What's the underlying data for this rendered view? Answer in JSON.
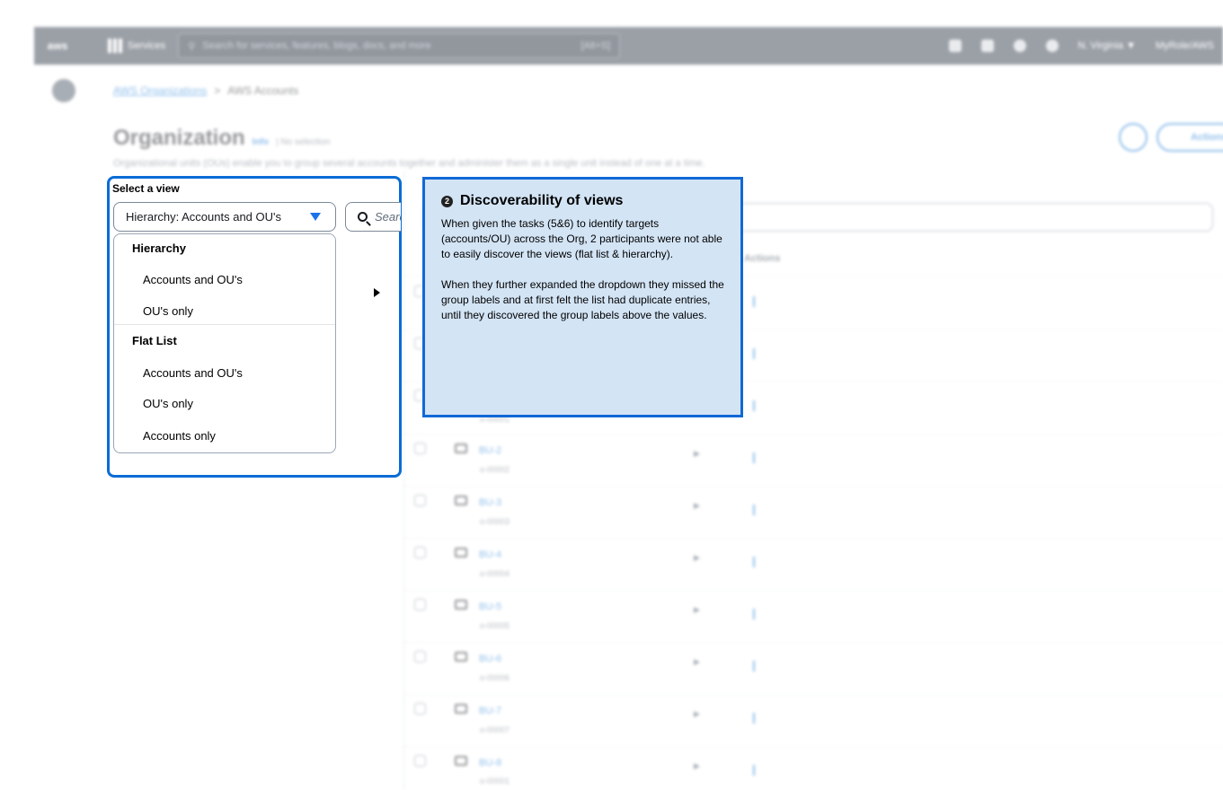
{
  "console": {
    "logo_text": "aws",
    "services_label": "Services",
    "search_placeholder": "Search for services, features, blogs, docs, and more",
    "search_shortcut": "[Alt+S]",
    "region_label": "N. Virginia ▼",
    "account_label": "MyRole/AWS",
    "breadcrumb_root": "AWS Organizations",
    "breadcrumb_sep": ">",
    "breadcrumb_current": "AWS Accounts",
    "page_title": "Organization",
    "info_link": "Info",
    "selection_status": "| No selection",
    "description": "Organizational units (OUs) enable you to group several accounts together and administer them as a single unit instead of one at a time.",
    "actions_label": "Actions",
    "column_actions": "Actions",
    "rows": [
      {
        "name": "BU-2",
        "id": "o-00002"
      },
      {
        "name": "BU-3",
        "id": "o-00003"
      },
      {
        "name": "BU-4",
        "id": "o-00004"
      },
      {
        "name": "BU-5",
        "id": "o-00005"
      },
      {
        "name": "BU-6",
        "id": "o-00006"
      },
      {
        "name": "BU-7",
        "id": "o-00007"
      },
      {
        "name": "BU-8",
        "id": "o-00001"
      }
    ],
    "row_top_id": "o-00001"
  },
  "view_selector": {
    "label": "Select a view",
    "selected": "Hierarchy: Accounts and OU's",
    "search_placeholder": "Search",
    "groups": [
      {
        "label": "Hierarchy",
        "options": [
          "Accounts and OU's",
          "OU's only"
        ]
      },
      {
        "label": "Flat List",
        "options": [
          "Accounts and OU's",
          "OU's only",
          "Accounts only"
        ]
      }
    ]
  },
  "callout": {
    "number": "2",
    "title": "Discoverability of views",
    "paragraph_1": "When given the tasks (5&6) to identify targets (accounts/OU) across the Org, 2 participants were not able to easily discover the views (flat list & hierarchy).",
    "paragraph_2": "When they further expanded the dropdown they missed the group labels and at first felt the list had duplicate entries, until they discovered the group labels above the values."
  },
  "colors": {
    "callout_bg": "#d3e4f5",
    "callout_border": "#1168d6",
    "console_nav": "#232f3e",
    "link": "#0972d3"
  }
}
